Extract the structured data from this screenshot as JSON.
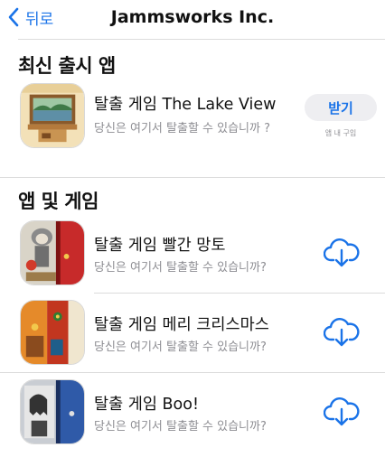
{
  "nav": {
    "back_label": "뒤로",
    "title": "Jammsworks Inc."
  },
  "sections": [
    {
      "title": "최신 출시 앱"
    },
    {
      "title": "앱 및 게임"
    }
  ],
  "latest_app": {
    "title": "탈출 게임 The Lake View",
    "subtitle": "당신은 여기서 탈출할 수 있습니까 ?",
    "button_label": "받기",
    "iap_label": "앱 내 구입",
    "icon": "lake-view-game-icon"
  },
  "apps": [
    {
      "title": "탈출 게임 빨간 망토",
      "subtitle": "당신은 여기서 탈출할 수 있습니까?",
      "icon": "red-riding-hood-game-icon",
      "action_icon": "cloud-download-icon"
    },
    {
      "title": "탈출 게임 메리 크리스마스",
      "subtitle": "당신은 여기서 탈출할 수 있습니까?",
      "icon": "merry-christmas-game-icon",
      "action_icon": "cloud-download-icon"
    },
    {
      "title": "탈출 게임 Boo!",
      "subtitle": "당신은 여기서 탈출할 수 있습니까?",
      "icon": "boo-game-icon",
      "action_icon": "cloud-download-icon"
    }
  ],
  "colors": {
    "accent": "#1a73e8",
    "secondary_text": "#8e8e93",
    "button_bg": "#eeeef1"
  }
}
